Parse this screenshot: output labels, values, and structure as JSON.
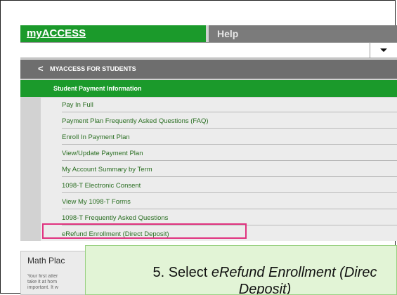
{
  "tabs": {
    "myaccess": "myACCESS",
    "help": "Help"
  },
  "select": {
    "value": ""
  },
  "menu": {
    "back_glyph": "<",
    "header": "MYACCESS FOR STUDENTS",
    "section": "Student Payment Information",
    "items": [
      "Pay In Full",
      "Payment Plan Frequently Asked Questions (FAQ)",
      "Enroll In Payment Plan",
      "View/Update Payment Plan",
      "My Account Summary by Term",
      "1098-T Electronic Consent",
      "View My 1098-T Forms",
      "1098-T Frequently Asked Questions",
      "eRefund Enrollment (Direct Deposit)"
    ]
  },
  "bottom_panel": {
    "title": "Math Plac",
    "lines": [
      "Your first atter",
      "take it at hom",
      "important. It w"
    ]
  },
  "callout": {
    "prefix": "5. Select ",
    "emphasis": "eRefund Enrollment (Direc",
    "line2": "Deposit)"
  },
  "colors": {
    "green": "#1b9a2b",
    "link_green": "#2a6e22",
    "highlight": "#e0327f",
    "callout_bg": "#e2f4d6"
  }
}
